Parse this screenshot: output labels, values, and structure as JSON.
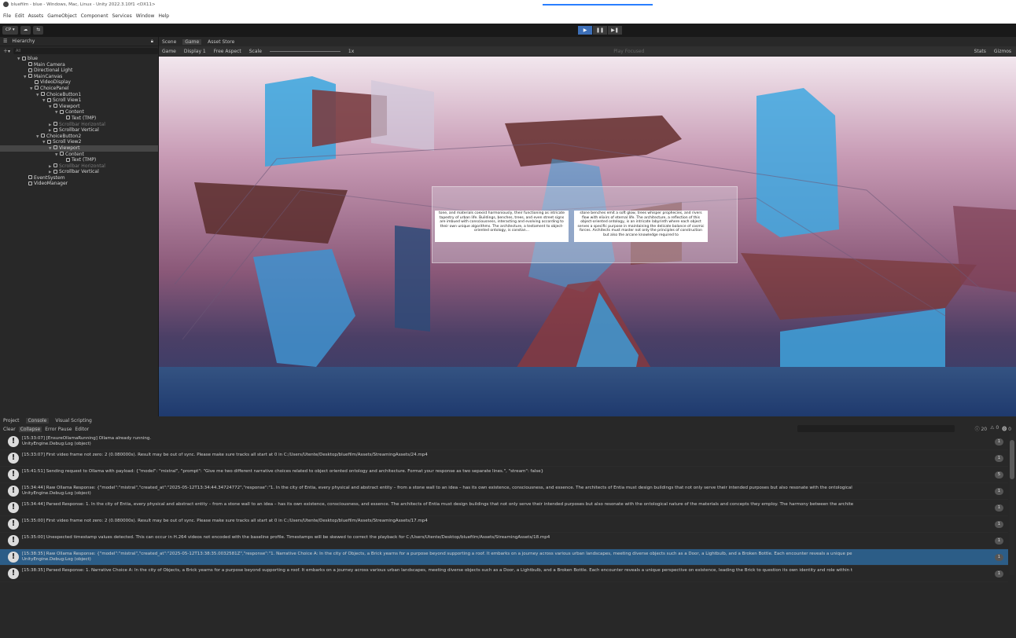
{
  "window": {
    "title": "bluefilm - blue - Windows, Mac, Linux - Unity 2022.3.10f1 <DX11>"
  },
  "menu": [
    "File",
    "Edit",
    "Assets",
    "GameObject",
    "Component",
    "Services",
    "Window",
    "Help"
  ],
  "toolbar": {
    "account": "CP",
    "play_icons": [
      "play-icon",
      "pause-icon",
      "step-icon"
    ]
  },
  "hierarchy": {
    "tab": "Hierarchy",
    "search_placeholder": "All",
    "items": [
      {
        "label": "blue",
        "depth": 0,
        "arrow": "▼",
        "selected": false,
        "dim": false
      },
      {
        "label": "Main Camera",
        "depth": 1,
        "arrow": "",
        "selected": false,
        "dim": false
      },
      {
        "label": "Directional Light",
        "depth": 1,
        "arrow": "",
        "selected": false,
        "dim": false
      },
      {
        "label": "MainCanvas",
        "depth": 1,
        "arrow": "▼",
        "selected": false,
        "dim": false
      },
      {
        "label": "VideoDisplay",
        "depth": 2,
        "arrow": "",
        "selected": false,
        "dim": false
      },
      {
        "label": "ChoicePanel",
        "depth": 2,
        "arrow": "▼",
        "selected": false,
        "dim": false
      },
      {
        "label": "ChoiceButton1",
        "depth": 3,
        "arrow": "▼",
        "selected": false,
        "dim": false
      },
      {
        "label": "Scroll View1",
        "depth": 4,
        "arrow": "▼",
        "selected": false,
        "dim": false
      },
      {
        "label": "Viewport",
        "depth": 5,
        "arrow": "▼",
        "selected": false,
        "dim": false
      },
      {
        "label": "Content",
        "depth": 6,
        "arrow": "▼",
        "selected": false,
        "dim": false
      },
      {
        "label": "Text (TMP)",
        "depth": 7,
        "arrow": "",
        "selected": false,
        "dim": false
      },
      {
        "label": "Scrollbar Horizontal",
        "depth": 5,
        "arrow": "▶",
        "selected": false,
        "dim": true
      },
      {
        "label": "Scrollbar Vertical",
        "depth": 5,
        "arrow": "▶",
        "selected": false,
        "dim": false
      },
      {
        "label": "ChoiceButton2",
        "depth": 3,
        "arrow": "▼",
        "selected": false,
        "dim": false
      },
      {
        "label": "Scroll View2",
        "depth": 4,
        "arrow": "▼",
        "selected": false,
        "dim": false
      },
      {
        "label": "Viewport",
        "depth": 5,
        "arrow": "▼",
        "selected": true,
        "dim": false
      },
      {
        "label": "Content",
        "depth": 6,
        "arrow": "▼",
        "selected": false,
        "dim": false
      },
      {
        "label": "Text (TMP)",
        "depth": 7,
        "arrow": "",
        "selected": false,
        "dim": false
      },
      {
        "label": "Scrollbar Horizontal",
        "depth": 5,
        "arrow": "▶",
        "selected": false,
        "dim": true
      },
      {
        "label": "Scrollbar Vertical",
        "depth": 5,
        "arrow": "▶",
        "selected": false,
        "dim": false
      },
      {
        "label": "EventSystem",
        "depth": 1,
        "arrow": "",
        "selected": false,
        "dim": false
      },
      {
        "label": "VideoManager",
        "depth": 1,
        "arrow": "",
        "selected": false,
        "dim": false
      }
    ]
  },
  "game_view": {
    "tabs": [
      "Scene",
      "Game",
      "Asset Store"
    ],
    "active_tab": "Game",
    "mode": "Game",
    "display": "Display 1",
    "aspect": "Free Aspect",
    "scale_label": "Scale",
    "scale_value": "1x",
    "play_focused": "Play Focused",
    "stats": "Stats",
    "gizmos": "Gizmos",
    "choice_left": "tone, and materials coexist harmoniously, their functioning as intricate tapestry of urban life. Buildings, benches, trees, and even street signs are imbued with consciousness, interacting and evolving according to their own unique algorithms. The architecture, a testament to object-oriented ontology, is constan... ",
    "choice_right": "stone benches emit a soft glow, trees whisper prophecies, and rivers flow with elixirs of eternal life. The architecture, a reflection of this object-oriented ontology, is an intricate labyrinth where each object serves a specific purpose in maintaining the delicate balance of cosmic forces. Architects must master not only the principles of construction but also the arcane knowledge required to"
  },
  "console": {
    "tabs": [
      "Project",
      "Console",
      "Visual Scripting"
    ],
    "active_tab": "Console",
    "buttons": [
      "Clear",
      "Collapse",
      "Error Pause",
      "Editor"
    ],
    "counts": {
      "logs": "20",
      "warnings": "0",
      "errors": "0"
    },
    "entries": [
      {
        "line1": "[15:33:07] [EnsureOllamaRunning] Ollama already running.",
        "line2": "UnityEngine.Debug:Log (object)",
        "count": "1",
        "selected": false
      },
      {
        "line1": "[15:33:07] First video frame not zero: 2 (0.080000s). Result may be out of sync. Please make sure tracks all start at 0 in C:/Users/Utente/Desktop/bluefilm/Assets/StreamingAssets/24.mp4",
        "line2": "",
        "count": "1",
        "selected": false
      },
      {
        "line1": "[15:41:51] Sending request to Ollama with payload: {\"model\": \"mistral\", \"prompt\": \"Give me two different narrative choices related to object oriented ontology and architecture. Format your response as two separate lines.\", \"stream\": false}",
        "line2": "",
        "count": "5",
        "selected": false
      },
      {
        "line1": "[15:34:44] Raw Ollama Response: {\"model\":\"mistral\",\"created_at\":\"2025-05-12T13:34:44.34724772\",\"response\":\"1. In the city of Entia, every physical and abstract entity – from a stone wall to an idea – has its own existence, consciousness, and essence. The architects of Entia must design buildings that not only serve their intended purposes but also resonate with the ontological",
        "line2": "UnityEngine.Debug:Log (object)",
        "count": "1",
        "selected": false
      },
      {
        "line1": "[15:34:44] Parsed Response: 1. In the city of Entia, every physical and abstract entity – from a stone wall to an idea – has its own existence, consciousness, and essence. The architects of Entia must design buildings that not only serve their intended purposes but also resonate with the ontological nature of the materials and concepts they employ. The harmony between the archite",
        "line2": "",
        "count": "1",
        "selected": false
      },
      {
        "line1": "[15:35:00] First video frame not zero: 2 (0.080000s). Result may be out of sync. Please make sure tracks all start at 0 in C:/Users/Utente/Desktop/bluefilm/Assets/StreamingAssets/17.mp4",
        "line2": "",
        "count": "1",
        "selected": false
      },
      {
        "line1": "[15:35:00] Unexpected timestamp values detected. This can occur in H.264 videos not encoded with the baseline profile. Timestamps will be skewed to correct the playback for C:/Users/Utente/Desktop/bluefilm/Assets/StreamingAssets/18.mp4",
        "line2": "",
        "count": "1",
        "selected": false
      },
      {
        "line1": "[15:38:35] Raw Ollama Response: {\"model\":\"mistral\",\"created_at\":\"2025-05-12T13:38:35.0032581Z\",\"response\":\"1. Narrative Choice A: In the city of Objects, a Brick yearns for a purpose beyond supporting a roof. It embarks on a journey across various urban landscapes, meeting diverse objects such as a Door, a Lightbulb, and a Broken Bottle. Each encounter reveals a unique pe",
        "line2": "UnityEngine.Debug:Log (object)",
        "count": "1",
        "selected": true
      },
      {
        "line1": "[15:38:35] Parsed Response: 1. Narrative Choice A: In the city of Objects, a Brick yearns for a purpose beyond supporting a roof. It embarks on a journey across various urban landscapes, meeting diverse objects such as a Door, a Lightbulb, and a Broken Bottle. Each encounter reveals a unique perspective on existence, leading the Brick to question its own identity and role within t",
        "line2": "",
        "count": "1",
        "selected": false
      }
    ]
  }
}
